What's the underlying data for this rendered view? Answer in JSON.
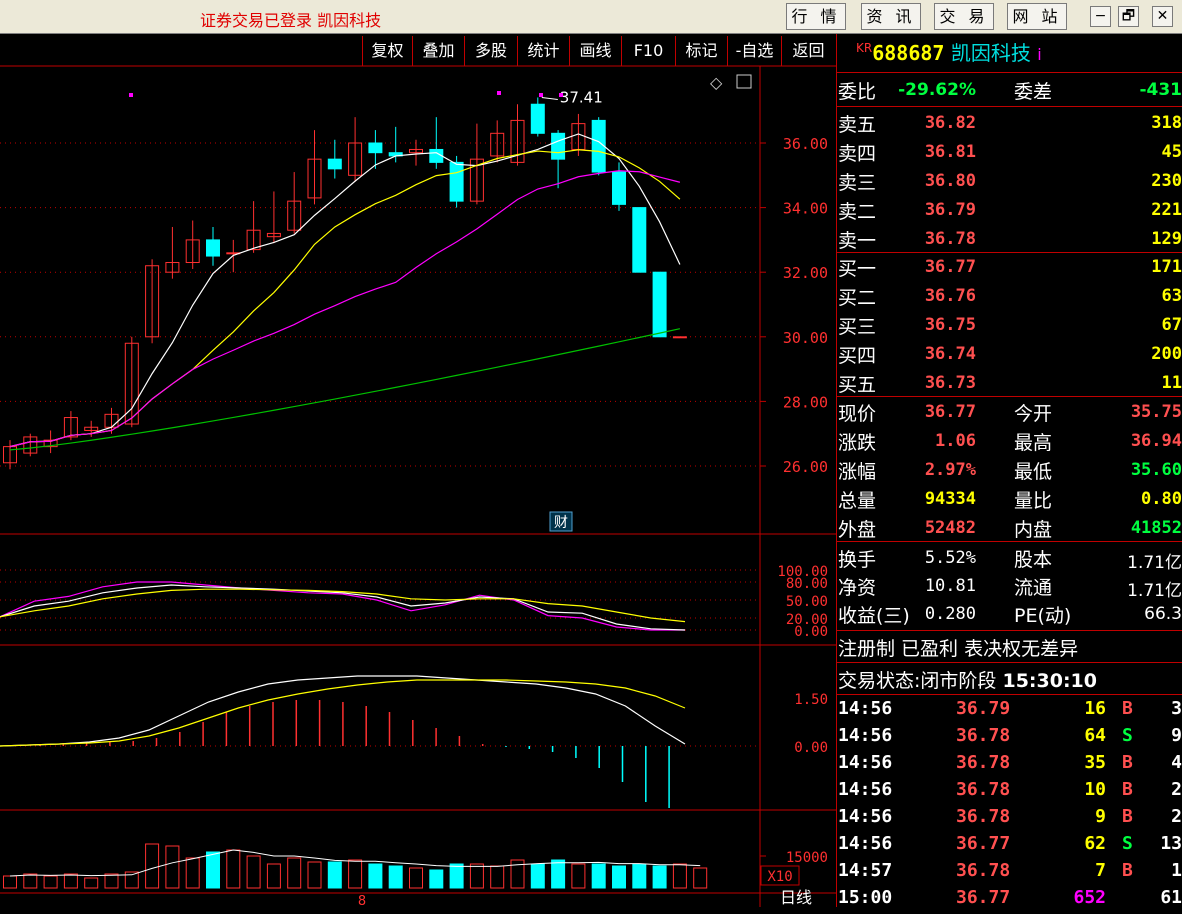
{
  "window": {
    "title": "证券交易已登录  凯因科技",
    "menu": [
      "行 情",
      "资 讯",
      "交 易",
      "网 站"
    ],
    "controls": [
      "−",
      "🗗",
      "✕"
    ]
  },
  "toolbar": [
    "复权",
    "叠加",
    "多股",
    "统计",
    "画线",
    "F10",
    "标记",
    "-自选",
    "返回"
  ],
  "stock": {
    "prefix": "KR",
    "code": "688687",
    "name": "凯因科技",
    "info_mark": "i"
  },
  "main_chart": {
    "price_labels": [
      "36.00",
      "34.00",
      "32.00",
      "30.00",
      "28.00",
      "26.00"
    ],
    "high_label": "37.41",
    "fin_marker": "财",
    "date_marker": "8"
  },
  "indicator1": {
    "labels": [
      "100.00",
      "80.00",
      "50.00",
      "20.00",
      "0.00"
    ]
  },
  "indicator2": {
    "labels": [
      "1.50",
      "0.00"
    ]
  },
  "volume": {
    "labels": [
      "15000",
      "X10"
    ],
    "period": "日线"
  },
  "order_book": {
    "wei_bi": {
      "label": "委比",
      "value": "-29.62%",
      "label2": "委差",
      "value2": "-431"
    },
    "sell": [
      {
        "label": "卖五",
        "price": "36.82",
        "vol": "318"
      },
      {
        "label": "卖四",
        "price": "36.81",
        "vol": "45"
      },
      {
        "label": "卖三",
        "price": "36.80",
        "vol": "230"
      },
      {
        "label": "卖二",
        "price": "36.79",
        "vol": "221"
      },
      {
        "label": "卖一",
        "price": "36.78",
        "vol": "129"
      }
    ],
    "buy": [
      {
        "label": "买一",
        "price": "36.77",
        "vol": "171"
      },
      {
        "label": "买二",
        "price": "36.76",
        "vol": "63"
      },
      {
        "label": "买三",
        "price": "36.75",
        "vol": "67"
      },
      {
        "label": "买四",
        "price": "36.74",
        "vol": "200"
      },
      {
        "label": "买五",
        "price": "36.73",
        "vol": "11"
      }
    ]
  },
  "quote": [
    {
      "l1": "现价",
      "v1": "36.77",
      "c1": "red",
      "l2": "今开",
      "v2": "35.75",
      "c2": "red"
    },
    {
      "l1": "涨跌",
      "v1": "1.06",
      "c1": "red",
      "l2": "最高",
      "v2": "36.94",
      "c2": "red"
    },
    {
      "l1": "涨幅",
      "v1": "2.97%",
      "c1": "red",
      "l2": "最低",
      "v2": "35.60",
      "c2": "green"
    },
    {
      "l1": "总量",
      "v1": "94334",
      "c1": "yellow",
      "l2": "量比",
      "v2": "0.80",
      "c2": "yellow"
    },
    {
      "l1": "外盘",
      "v1": "52482",
      "c1": "red",
      "l2": "内盘",
      "v2": "41852",
      "c2": "green"
    }
  ],
  "fundamentals": [
    {
      "l1": "换手",
      "v1": "5.52%",
      "l2": "股本",
      "v2": "1.71亿"
    },
    {
      "l1": "净资",
      "v1": "10.81",
      "l2": "流通",
      "v2": "1.71亿"
    },
    {
      "l1": "收益(三)",
      "v1": "0.280",
      "l2": "PE(动)",
      "v2": "66.3"
    }
  ],
  "tags": "注册制 已盈利 表决权无差异",
  "status": {
    "label": "交易状态:",
    "value": "闭市阶段",
    "time": "15:30:10"
  },
  "ticks": [
    {
      "time": "14:56",
      "price": "36.79",
      "vol": "16",
      "side": "B",
      "n": "3"
    },
    {
      "time": "14:56",
      "price": "36.78",
      "vol": "64",
      "side": "S",
      "n": "9"
    },
    {
      "time": "14:56",
      "price": "36.78",
      "vol": "35",
      "side": "B",
      "n": "4"
    },
    {
      "time": "14:56",
      "price": "36.78",
      "vol": "10",
      "side": "B",
      "n": "2"
    },
    {
      "time": "14:56",
      "price": "36.78",
      "vol": "9",
      "side": "B",
      "n": "2"
    },
    {
      "time": "14:56",
      "price": "36.77",
      "vol": "62",
      "side": "S",
      "n": "13"
    },
    {
      "time": "14:57",
      "price": "36.78",
      "vol": "7",
      "side": "B",
      "n": "1"
    },
    {
      "time": "15:00",
      "price": "36.77",
      "vol": "652",
      "side": "",
      "n": "61"
    }
  ],
  "colors": {
    "up": "#ff3030",
    "down": "#00ffff",
    "grid": "#c00000",
    "ma1": "#ffffff",
    "ma2": "#ffff00",
    "ma3": "#ff00ff",
    "ma4": "#00c000"
  }
}
